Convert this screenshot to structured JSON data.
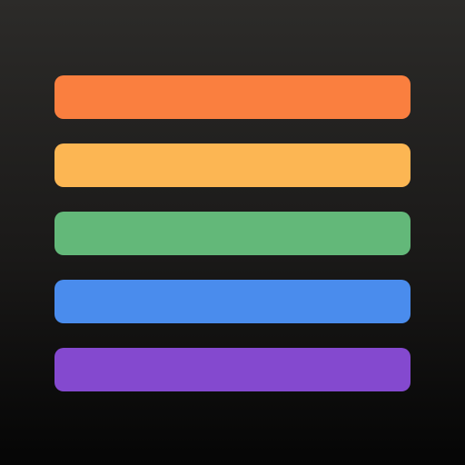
{
  "app_icon": {
    "background": {
      "top_color": "#2c2b29",
      "bottom_color": "#050505"
    },
    "bars": [
      {
        "name": "orange",
        "color": "#fa7f3f"
      },
      {
        "name": "yellow",
        "color": "#fcb653"
      },
      {
        "name": "green",
        "color": "#63b879"
      },
      {
        "name": "blue",
        "color": "#4a8ced"
      },
      {
        "name": "purple",
        "color": "#8449cf"
      }
    ]
  }
}
